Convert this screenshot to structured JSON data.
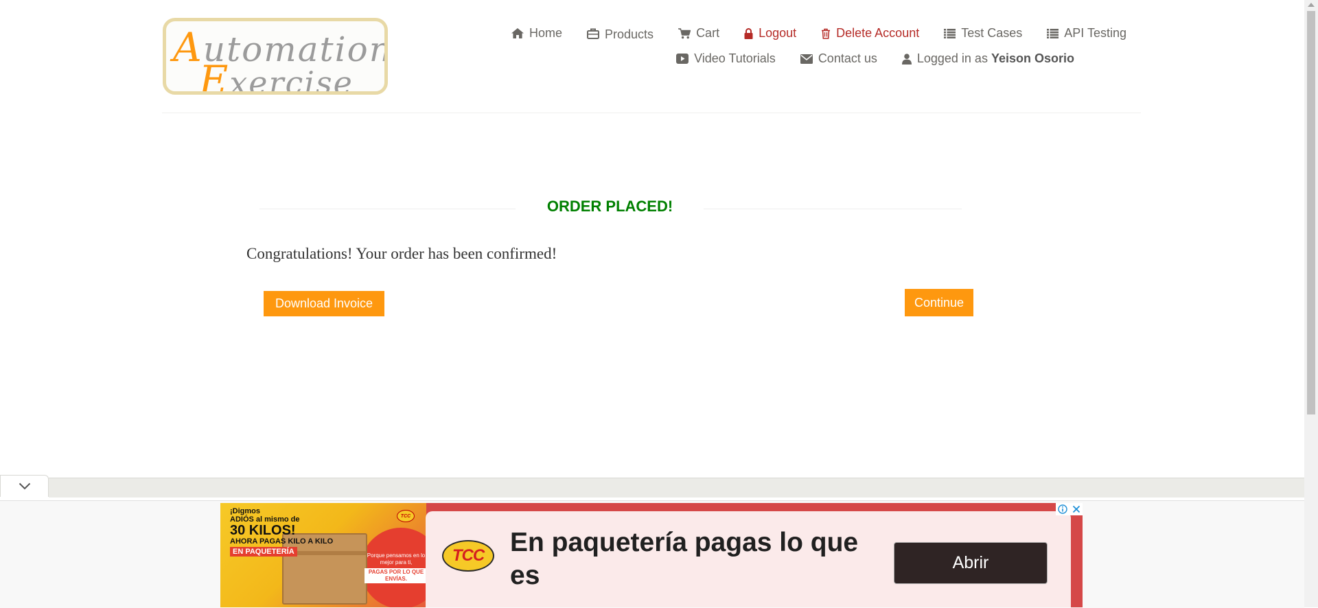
{
  "logo": {
    "line1_cap": "A",
    "line1_rest": "utomation",
    "line2_cap": "E",
    "line2_rest": "xercise"
  },
  "nav": {
    "home": "Home",
    "products": "Products",
    "cart": "Cart",
    "logout": "Logout",
    "delete_account": "Delete Account",
    "test_cases": "Test Cases",
    "api_testing": "API Testing",
    "video_tutorials": "Video Tutorials",
    "contact_us": "Contact us",
    "logged_in_prefix": "Logged in as",
    "username": "Yeison Osorio"
  },
  "order": {
    "title": "ORDER PLACED!",
    "message": "Congratulations! Your order has been confirmed!",
    "download_invoice": "Download Invoice",
    "continue": "Continue"
  },
  "ad": {
    "promo_line1": "¡Digmos",
    "promo_line2": "ADIÓS al mismo de",
    "promo_big": "30 KILOS!",
    "promo_line3": "AHORA PAGAS KILO A KILO",
    "promo_tag": "EN PAQUETERÍA",
    "right_text": "Porque pensamos en lo mejor para ti,",
    "right_emph": "PAGAS POR LO QUE ENVÍAS.",
    "brand": "TCC",
    "headline": "En paquetería pagas lo que es",
    "cta": "Abrir"
  },
  "colors": {
    "accent_orange": "#fe980f",
    "success_green": "#008000",
    "danger_red": "#b52b27",
    "ad_red": "#d54848"
  }
}
